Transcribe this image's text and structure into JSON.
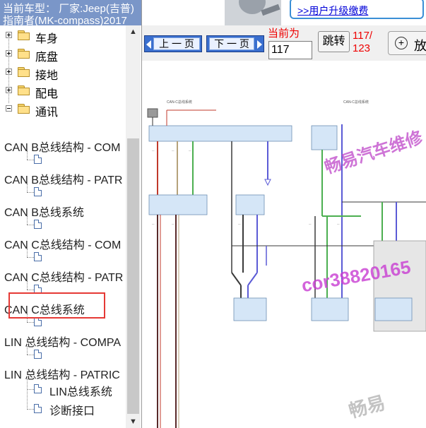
{
  "header": {
    "car_label": "当前车型：  厂家:Jeep(吉普)指南者(MK-compass)2017"
  },
  "banner": {
    "renew_link": ">>用户升级缴费"
  },
  "tree": {
    "folders": [
      {
        "label": "车身",
        "state": "collapsed"
      },
      {
        "label": "底盘",
        "state": "collapsed"
      },
      {
        "label": "接地",
        "state": "collapsed"
      },
      {
        "label": "配电",
        "state": "collapsed"
      },
      {
        "label": "通讯",
        "state": "expanded"
      }
    ],
    "documents": [
      "CAN B总线结构 - COM",
      "CAN B总线结构 - PATR",
      "CAN B总线系统",
      "CAN C总线结构 - COM",
      "CAN C总线结构 - PATR",
      "CAN C总线系统",
      "LIN 总线结构 - COMPA",
      "LIN 总线结构 - PATRIC"
    ],
    "subitems": [
      "LIN总线系统",
      "诊断接口"
    ],
    "selected": "CAN C总线系统"
  },
  "toolbar": {
    "prev_label": "上 一 页",
    "next_label": "下 一 页",
    "current_label": "当前为",
    "page_value": "117",
    "jump_label": "跳转",
    "page_count_top": "117/",
    "page_count_bottom": "123",
    "zoom_label": "放"
  },
  "diagram": {
    "title": "CAN-C总线系统",
    "watermarks": [
      "畅易汽车维修",
      "cor38820165",
      "畅易"
    ]
  },
  "colors": {
    "header_bg": "#7a96c8",
    "selection_border": "#e53935",
    "wire_red": "#c0392b",
    "wire_blue": "#5b5bd6",
    "wire_green": "#4caf50",
    "wire_tan": "#b5a27a",
    "wire_dark": "#3a3a3a"
  },
  "icons": {
    "folder": "folder-icon",
    "document": "document-icon",
    "zoom": "zoom-in-icon"
  }
}
